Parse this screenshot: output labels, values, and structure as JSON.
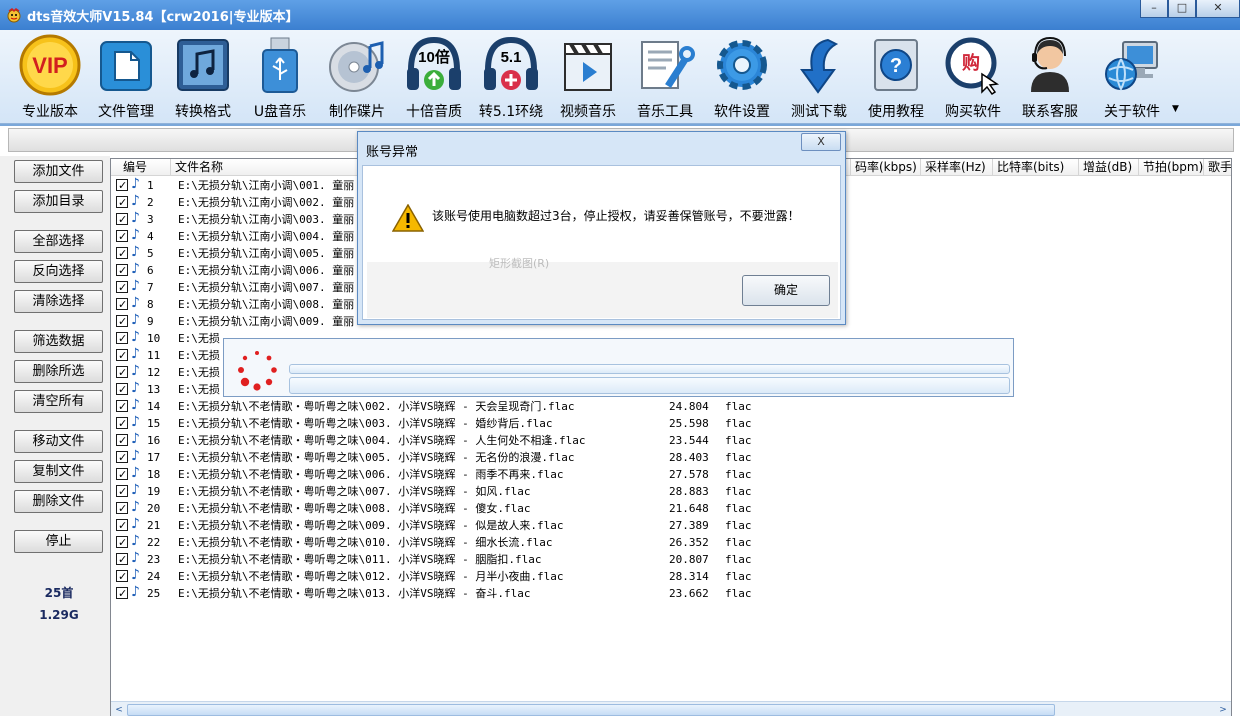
{
  "window": {
    "title": "dts音效大师V15.84【crw2016|专业版本】",
    "minimize": "–",
    "maximize": "□",
    "close": "✕"
  },
  "toolbar": {
    "items": [
      {
        "label": "专业版本",
        "icon": "vip-badge-icon",
        "icon_text": "VIP"
      },
      {
        "label": "文件管理",
        "icon": "file-manager-icon"
      },
      {
        "label": "转换格式",
        "icon": "music-convert-icon"
      },
      {
        "label": "U盘音乐",
        "icon": "usb-drive-icon"
      },
      {
        "label": "制作碟片",
        "icon": "cd-disc-icon"
      },
      {
        "label": "十倍音质",
        "icon": "headphones-10x-icon",
        "icon_text": "10倍"
      },
      {
        "label": "转5.1环绕",
        "icon": "headphones-51-icon",
        "icon_text": "5.1"
      },
      {
        "label": "视频音乐",
        "icon": "video-clapper-icon"
      },
      {
        "label": "音乐工具",
        "icon": "tools-icon"
      },
      {
        "label": "软件设置",
        "icon": "gear-icon"
      },
      {
        "label": "测试下载",
        "icon": "download-arrow-icon"
      },
      {
        "label": "使用教程",
        "icon": "help-book-icon"
      },
      {
        "label": "购买软件",
        "icon": "buy-cart-icon",
        "icon_text": "购"
      },
      {
        "label": "联系客服",
        "icon": "customer-service-icon"
      },
      {
        "label": "关于软件",
        "icon": "computer-globe-icon"
      }
    ],
    "more": "▼"
  },
  "sidebar": {
    "buttons": [
      "添加文件",
      "添加目录",
      "全部选择",
      "反向选择",
      "清除选择",
      "筛选数据",
      "删除所选",
      "清空所有",
      "移动文件",
      "复制文件",
      "删除文件",
      "停止"
    ],
    "count": "25首",
    "size": "1.29G"
  },
  "list": {
    "headers": [
      "编号",
      "文件名称",
      "码率(kbps)",
      "采样率(Hz)",
      "比特率(bits)",
      "增益(dB)",
      "节拍(bpm)",
      "歌手"
    ],
    "rows": [
      {
        "num": "1",
        "path": "E:\\无损分轨\\江南小调\\001. 童丽"
      },
      {
        "num": "2",
        "path": "E:\\无损分轨\\江南小调\\002. 童丽"
      },
      {
        "num": "3",
        "path": "E:\\无损分轨\\江南小调\\003. 童丽"
      },
      {
        "num": "4",
        "path": "E:\\无损分轨\\江南小调\\004. 童丽"
      },
      {
        "num": "5",
        "path": "E:\\无损分轨\\江南小调\\005. 童丽"
      },
      {
        "num": "6",
        "path": "E:\\无损分轨\\江南小调\\006. 童丽"
      },
      {
        "num": "7",
        "path": "E:\\无损分轨\\江南小调\\007. 童丽"
      },
      {
        "num": "8",
        "path": "E:\\无损分轨\\江南小调\\008. 童丽"
      },
      {
        "num": "9",
        "path": "E:\\无损分轨\\江南小调\\009. 童丽"
      },
      {
        "num": "10",
        "path": "E:\\无损"
      },
      {
        "num": "11",
        "path": "E:\\无损"
      },
      {
        "num": "12",
        "path": "E:\\无损"
      },
      {
        "num": "13",
        "path": "E:\\无损"
      },
      {
        "num": "14",
        "path": "E:\\无损分轨\\不老情歌・粤听粤之味\\002. 小洋VS晓辉 - 天会呈现奇门.flac",
        "dur": "24.804",
        "fmt": "flac"
      },
      {
        "num": "15",
        "path": "E:\\无损分轨\\不老情歌・粤听粤之味\\003. 小洋VS晓辉 - 婚纱背后.flac",
        "dur": "25.598",
        "fmt": "flac"
      },
      {
        "num": "16",
        "path": "E:\\无损分轨\\不老情歌・粤听粤之味\\004. 小洋VS晓辉 - 人生何处不相逢.flac",
        "dur": "23.544",
        "fmt": "flac"
      },
      {
        "num": "17",
        "path": "E:\\无损分轨\\不老情歌・粤听粤之味\\005. 小洋VS晓辉 - 无名份的浪漫.flac",
        "dur": "28.403",
        "fmt": "flac"
      },
      {
        "num": "18",
        "path": "E:\\无损分轨\\不老情歌・粤听粤之味\\006. 小洋VS晓辉 - 雨季不再来.flac",
        "dur": "27.578",
        "fmt": "flac"
      },
      {
        "num": "19",
        "path": "E:\\无损分轨\\不老情歌・粤听粤之味\\007. 小洋VS晓辉 - 如风.flac",
        "dur": "28.883",
        "fmt": "flac"
      },
      {
        "num": "20",
        "path": "E:\\无损分轨\\不老情歌・粤听粤之味\\008. 小洋VS晓辉 - 傻女.flac",
        "dur": "21.648",
        "fmt": "flac"
      },
      {
        "num": "21",
        "path": "E:\\无损分轨\\不老情歌・粤听粤之味\\009. 小洋VS晓辉 - 似是故人来.flac",
        "dur": "27.389",
        "fmt": "flac"
      },
      {
        "num": "22",
        "path": "E:\\无损分轨\\不老情歌・粤听粤之味\\010. 小洋VS晓辉 - 细水长流.flac",
        "dur": "26.352",
        "fmt": "flac"
      },
      {
        "num": "23",
        "path": "E:\\无损分轨\\不老情歌・粤听粤之味\\011. 小洋VS晓辉 - 胭脂扣.flac",
        "dur": "20.807",
        "fmt": "flac"
      },
      {
        "num": "24",
        "path": "E:\\无损分轨\\不老情歌・粤听粤之味\\012. 小洋VS晓辉 - 月半小夜曲.flac",
        "dur": "28.314",
        "fmt": "flac"
      },
      {
        "num": "25",
        "path": "E:\\无损分轨\\不老情歌・粤听粤之味\\013. 小洋VS晓辉 - 奋斗.flac",
        "dur": "23.662",
        "fmt": "flac"
      }
    ],
    "scroll_left": "<",
    "scroll_right": ">"
  },
  "dialog": {
    "title": "账号异常",
    "close": "X",
    "message": "该账号使用电脑数超过3台，停止授权，请妥善保管账号，不要泄露！",
    "ghost_menu": "矩形截图(R)",
    "ok": "确定"
  },
  "colors": {
    "title_bar": "#3b7fd0",
    "accent": "#1e5fb8",
    "warning": "#f5b800"
  }
}
